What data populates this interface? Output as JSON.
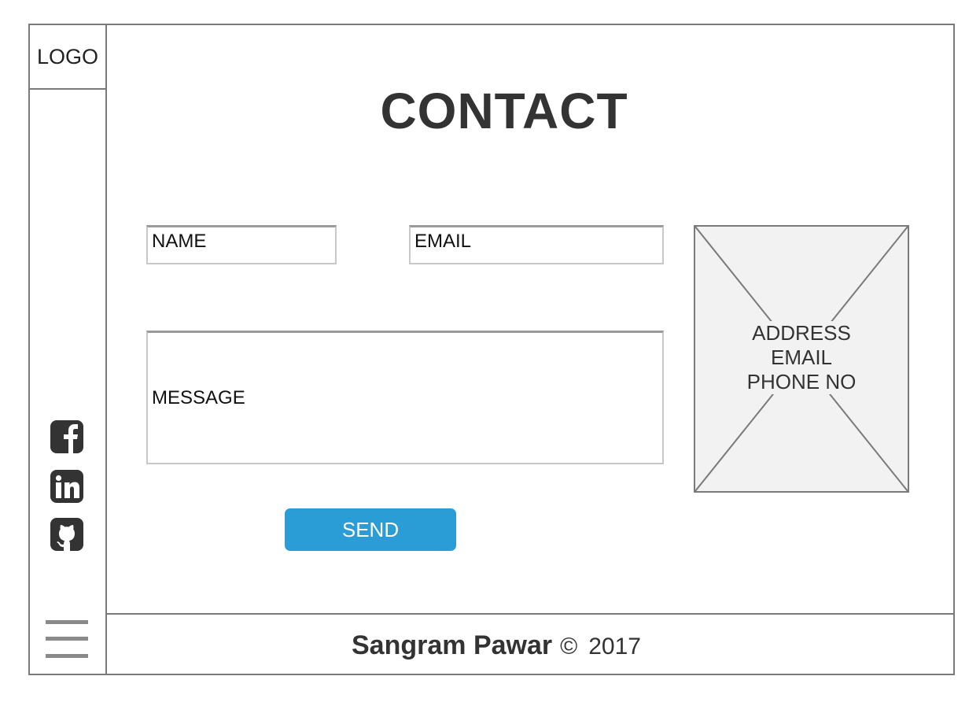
{
  "logo": "LOGO",
  "page_title": "CONTACT",
  "form": {
    "name_placeholder": "NAME",
    "email_placeholder": "EMAIL",
    "message_placeholder": "MESSAGE",
    "send_label": "SEND"
  },
  "info_box": {
    "lines": [
      "ADDRESS",
      "EMAIL",
      "PHONE NO"
    ]
  },
  "social": [
    "facebook-icon",
    "linkedin-icon",
    "github-icon"
  ],
  "footer": {
    "name": "Sangram Pawar",
    "copyright_symbol": "©",
    "year": "2017"
  },
  "colors": {
    "button": "#2a9cd6",
    "border": "#7a7a7a",
    "text": "#333333",
    "placeholder_fill": "#f2f2f2"
  }
}
